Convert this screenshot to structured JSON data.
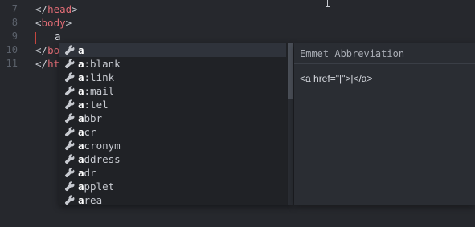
{
  "editor": {
    "lines": [
      {
        "num": "7",
        "open": "</",
        "tag": "head",
        "close": ">"
      },
      {
        "num": "8",
        "open": "<",
        "tag": "body",
        "close": ">"
      },
      {
        "num": "9",
        "typed": "a"
      },
      {
        "num": "10",
        "open": "</",
        "tag": "bod",
        "close": ""
      },
      {
        "num": "11",
        "open": "</",
        "tag": "htm",
        "close": ""
      }
    ]
  },
  "autocomplete": {
    "items": [
      {
        "match": "a",
        "rest": ""
      },
      {
        "match": "a",
        "rest": ":blank"
      },
      {
        "match": "a",
        "rest": ":link"
      },
      {
        "match": "a",
        "rest": ":mail"
      },
      {
        "match": "a",
        "rest": ":tel"
      },
      {
        "match": "a",
        "rest": "bbr"
      },
      {
        "match": "a",
        "rest": "cr"
      },
      {
        "match": "a",
        "rest": "cronym"
      },
      {
        "match": "a",
        "rest": "ddress"
      },
      {
        "match": "a",
        "rest": "dr"
      },
      {
        "match": "a",
        "rest": "pplet"
      },
      {
        "match": "a",
        "rest": "rea"
      }
    ],
    "icon": "wrench-icon",
    "selected_index": 0
  },
  "doc_panel": {
    "title": "Emmet Abbreviation",
    "snippet": "<a href=\"|\">|</a>"
  },
  "colors": {
    "background": "#26282d",
    "tag": "#e06c75",
    "popup_bg": "#202226",
    "doc_bg": "#2a2d33"
  }
}
